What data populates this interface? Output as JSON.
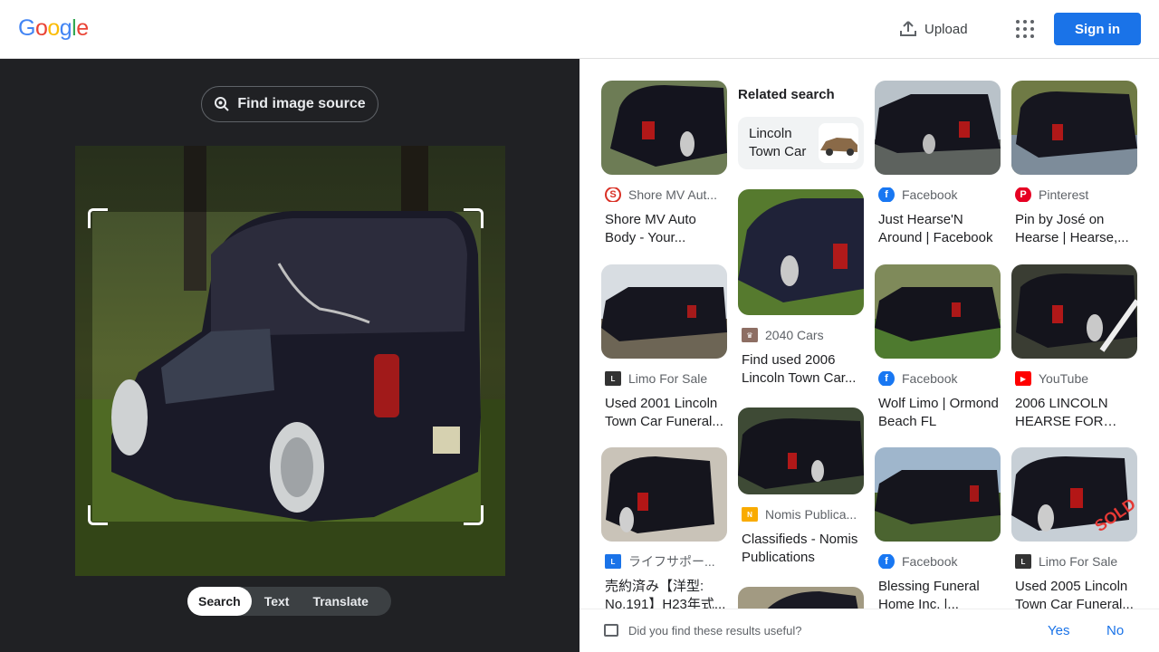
{
  "header": {
    "logo": [
      "G",
      "o",
      "o",
      "g",
      "l",
      "e"
    ],
    "logo_colors": [
      "#4285F4",
      "#EA4335",
      "#FBBC05",
      "#4285F4",
      "#34A853",
      "#EA4335"
    ],
    "upload_label": "Upload",
    "signin_label": "Sign in"
  },
  "left": {
    "find_source_label": "Find image source",
    "modes": [
      "Search",
      "Text",
      "Translate"
    ],
    "active_mode": "Search"
  },
  "related": {
    "heading": "Related search",
    "chip_label": "Lincoln Town Car"
  },
  "results": [
    {
      "source": "Shore MV Aut...",
      "title": "Shore MV Auto Body - Your...",
      "favicon_color": "#d93025",
      "icon": "shore-favicon"
    },
    {
      "source": "Facebook",
      "title": "Just Hearse'N Around | Facebook",
      "favicon_color": "#1877f2",
      "icon": "facebook-favicon"
    },
    {
      "source": "Pinterest",
      "title": "Pin by José on Hearse | Hearse,...",
      "favicon_color": "#e60023",
      "icon": "pinterest-favicon"
    },
    {
      "source": "2040 Cars",
      "title": "Find used 2006 Lincoln Town Car...",
      "favicon_color": "#8d6e63",
      "icon": "2040cars-favicon"
    },
    {
      "source": "Limo For Sale",
      "title": "Used 2001 Lincoln Town Car Funeral...",
      "favicon_color": "#333333",
      "icon": "limo-favicon"
    },
    {
      "source": "Facebook",
      "title": "Wolf Limo | Ormond Beach FL",
      "favicon_color": "#1877f2",
      "icon": "facebook-favicon"
    },
    {
      "source": "YouTube",
      "title": "2006 LINCOLN HEARSE FOR SAL...",
      "favicon_color": "#ff0000",
      "icon": "youtube-favicon"
    },
    {
      "source": "Nomis Publica...",
      "title": "Classifieds - Nomis Publications",
      "favicon_color": "#f9ab00",
      "icon": "nomis-favicon"
    },
    {
      "source": "ライフサポー...",
      "title": "売約済み【洋型: No.191】H23年式...",
      "favicon_color": "#1a73e8",
      "icon": "lifesupport-favicon"
    },
    {
      "source": "Facebook",
      "title": "Blessing Funeral Home Inc. |...",
      "favicon_color": "#1877f2",
      "icon": "facebook-favicon"
    },
    {
      "source": "Limo For Sale",
      "title": "Used 2005 Lincoln Town Car Funeral...",
      "favicon_color": "#333333",
      "icon": "limo-favicon"
    }
  ],
  "feedback": {
    "question": "Did you find these results useful?",
    "yes": "Yes",
    "no": "No"
  }
}
